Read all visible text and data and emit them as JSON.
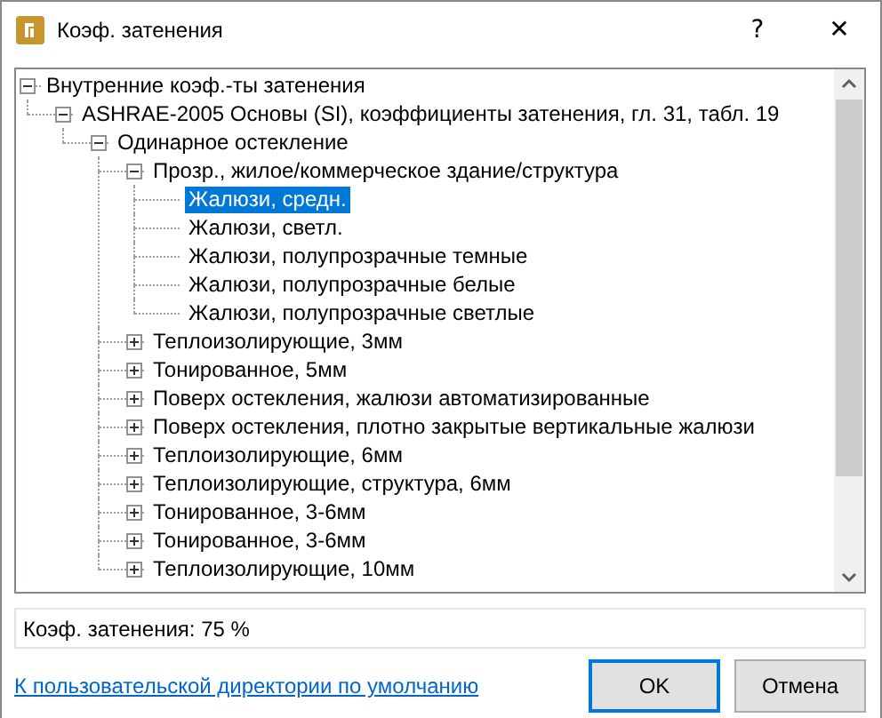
{
  "window": {
    "title": "Коэф. затенения",
    "help": "?",
    "close": "✕"
  },
  "tree": [
    {
      "label": "Внутренние коэф.-ты затенения",
      "expanded": true,
      "selected": false,
      "children": [
        {
          "label": "ASHRAE-2005 Основы (SI), коэффициенты затенения, гл. 31, табл. 19",
          "expanded": true,
          "selected": false,
          "children": [
            {
              "label": "Одинарное остекление",
              "expanded": true,
              "selected": false,
              "children": [
                {
                  "label": "Прозр., жилое/коммерческое здание/структура",
                  "expanded": true,
                  "selected": false,
                  "children": [
                    {
                      "label": "Жалюзи, средн.",
                      "selected": true
                    },
                    {
                      "label": "Жалюзи, светл.",
                      "selected": false
                    },
                    {
                      "label": "Жалюзи, полупрозрачные темные",
                      "selected": false
                    },
                    {
                      "label": "Жалюзи, полупрозрачные белые",
                      "selected": false
                    },
                    {
                      "label": "Жалюзи, полупрозрачные светлые",
                      "selected": false
                    }
                  ]
                },
                {
                  "label": "Теплоизолирующие, 3мм",
                  "expanded": false,
                  "selected": false
                },
                {
                  "label": "Тонированное, 5мм",
                  "expanded": false,
                  "selected": false
                },
                {
                  "label": "Поверх остекления, жалюзи автоматизированные",
                  "expanded": false,
                  "selected": false
                },
                {
                  "label": "Поверх остекления, плотно закрытые вертикальные жалюзи",
                  "expanded": false,
                  "selected": false
                },
                {
                  "label": "Теплоизолирующие, 6мм",
                  "expanded": false,
                  "selected": false
                },
                {
                  "label": "Теплоизолирующие, структура, 6мм",
                  "expanded": false,
                  "selected": false
                },
                {
                  "label": "Тонированное, 3-6мм",
                  "expanded": false,
                  "selected": false
                },
                {
                  "label": "Тонированное, 3-6мм",
                  "expanded": false,
                  "selected": false
                },
                {
                  "label": "Теплоизолирующие, 10мм",
                  "expanded": false,
                  "selected": false
                }
              ]
            }
          ]
        }
      ]
    }
  ],
  "status_text": "Коэф. затенения: 75 %",
  "link": "К пользовательской директории по умолчанию",
  "buttons": [
    {
      "label": "OK",
      "default": true
    },
    {
      "label": "Отмена",
      "default": false
    }
  ]
}
